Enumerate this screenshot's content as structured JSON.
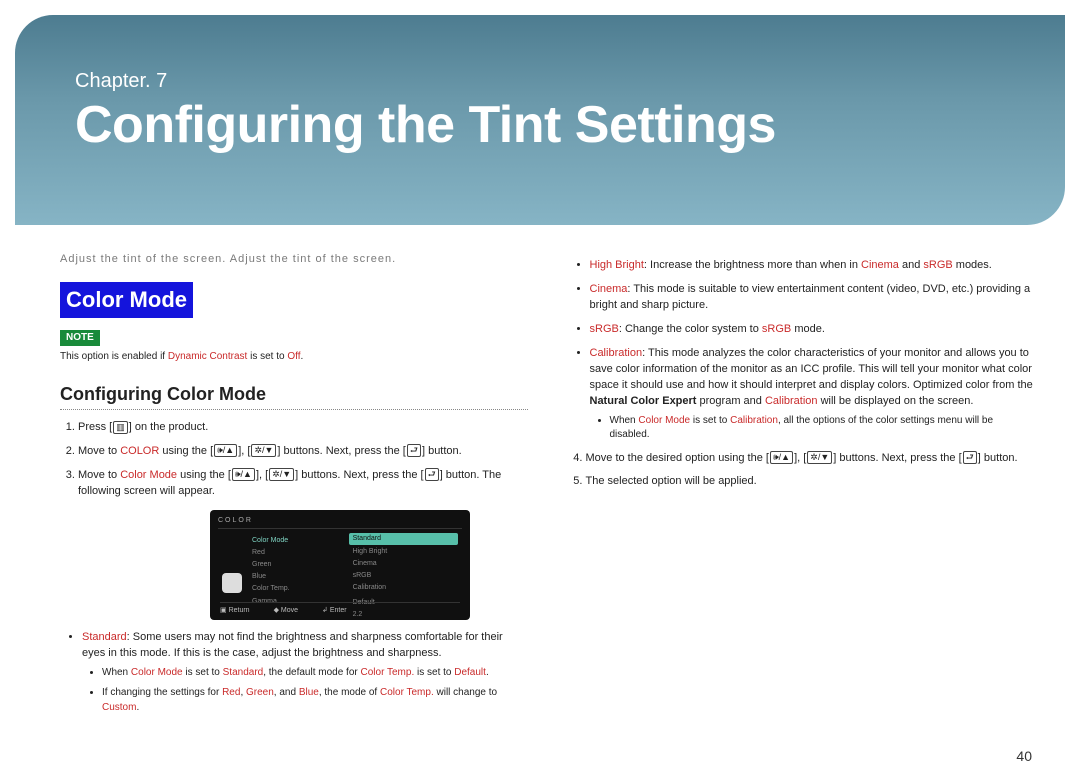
{
  "header": {
    "chapter_label": "Chapter. 7",
    "chapter_title": "Configuring the Tint Settings"
  },
  "intro": "Adjust the tint of the screen. Adjust the tint of the screen.",
  "block_heading": "Color Mode",
  "note": {
    "badge": "NOTE",
    "prefix": "This option is enabled if ",
    "accent": "Dynamic Contrast",
    "mid": " is set to ",
    "value": "Off",
    "suffix": "."
  },
  "sub_heading": "Configuring Color Mode",
  "steps_left": {
    "s1_a": "Press [",
    "s1_icon": "▥",
    "s1_b": "] on the product.",
    "s2_a": "Move to ",
    "s2_color": "COLOR",
    "s2_b": " using the ",
    "s2_c": " buttons. Next, press the ",
    "s2_d": " button.",
    "s3_a": "Move to ",
    "s3_color": "Color Mode",
    "s3_b": " using the ",
    "s3_c": " buttons. Next, press the ",
    "s3_d": " button. The following screen will appear."
  },
  "icons": {
    "vol_up": "🕪/▲",
    "bc_down": "✲/▼",
    "enter": "⮐"
  },
  "osd": {
    "title": "COLOR",
    "left_items": [
      "Color Mode",
      "Red",
      "Green",
      "Blue",
      "Color Temp.",
      "Gamma"
    ],
    "right_items": [
      "Standard",
      "High Bright",
      "Cinema",
      "sRGB",
      "Calibration"
    ],
    "right_vals": {
      "temp": "Default",
      "gamma": "2.2"
    },
    "footer": {
      "return": "Return",
      "move": "Move",
      "enter": "Enter"
    }
  },
  "left_bullets": {
    "std_label": "Standard",
    "std_text": ": Some users may not find the brightness and sharpness comfortable for their eyes in this mode. If this is the case, adjust the brightness and sharpness.",
    "sub1_a": "When ",
    "sub1_cm": "Color Mode",
    "sub1_b": " is set to ",
    "sub1_std": "Standard",
    "sub1_c": ", the default mode for ",
    "sub1_ct": "Color Temp.",
    "sub1_d": " is set to ",
    "sub1_def": "Default",
    "sub1_e": ".",
    "sub2_a": "If changing the settings for ",
    "sub2_r": "Red",
    "sub2_g": "Green",
    "sub2_bl": "Blue",
    "sub2_and": ", and ",
    "sub2_comma": ", ",
    "sub2_b": ", the mode of ",
    "sub2_ct": "Color Temp.",
    "sub2_c": " will change to ",
    "sub2_cu": "Custom",
    "sub2_d": "."
  },
  "right_bullets": {
    "hb_label": "High Bright",
    "hb_a": ": Increase the brightness more than when in ",
    "hb_cin": "Cinema",
    "hb_and": " and ",
    "hb_srgb": "sRGB",
    "hb_b": " modes.",
    "cin_label": "Cinema",
    "cin_txt": ": This mode is suitable to view entertainment content (video, DVD, etc.) providing a bright and sharp picture.",
    "srgb_label": "sRGB",
    "srgb_a": ": Change the color system to ",
    "srgb_v": "sRGB",
    "srgb_b": " mode.",
    "cal_label": "Calibration",
    "cal_txt_a": ": This mode analyzes the color characteristics of your monitor and allows you to save color information of the monitor as an ICC profile. This will tell your monitor what color space it should use and how it should interpret and display colors. Optimized color from the ",
    "cal_bold": "Natural Color Expert",
    "cal_txt_b": " program and ",
    "cal_cal": "Calibration",
    "cal_txt_c": " will be displayed on the screen.",
    "cal_sub_a": "When ",
    "cal_sub_cm": "Color Mode",
    "cal_sub_b": " is set to ",
    "cal_sub_cal": "Calibration",
    "cal_sub_c": ", all the options of the color settings menu will be disabled."
  },
  "steps_right": {
    "s4_a": "Move to the desired option using the ",
    "s4_b": " buttons. Next, press the ",
    "s4_c": " button.",
    "s5": "The selected option will be applied."
  },
  "page_number": "40"
}
